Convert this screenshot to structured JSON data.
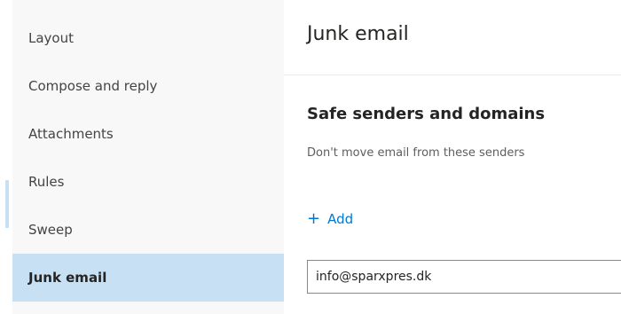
{
  "sidebar": {
    "items": [
      {
        "label": "Layout"
      },
      {
        "label": "Compose and reply"
      },
      {
        "label": "Attachments"
      },
      {
        "label": "Rules"
      },
      {
        "label": "Sweep"
      },
      {
        "label": "Junk email",
        "selected": true
      }
    ]
  },
  "main": {
    "title": "Junk email",
    "section": {
      "title": "Safe senders and domains",
      "description": "Don't move email from these senders"
    },
    "add_label": "Add",
    "add_icon": "plus-icon",
    "email_input": {
      "value": "info@sparxpres.dk"
    }
  },
  "colors": {
    "selected_bg": "#c7e0f4",
    "accent": "#0078d4",
    "sidebar_bg": "#f8f8f8"
  }
}
